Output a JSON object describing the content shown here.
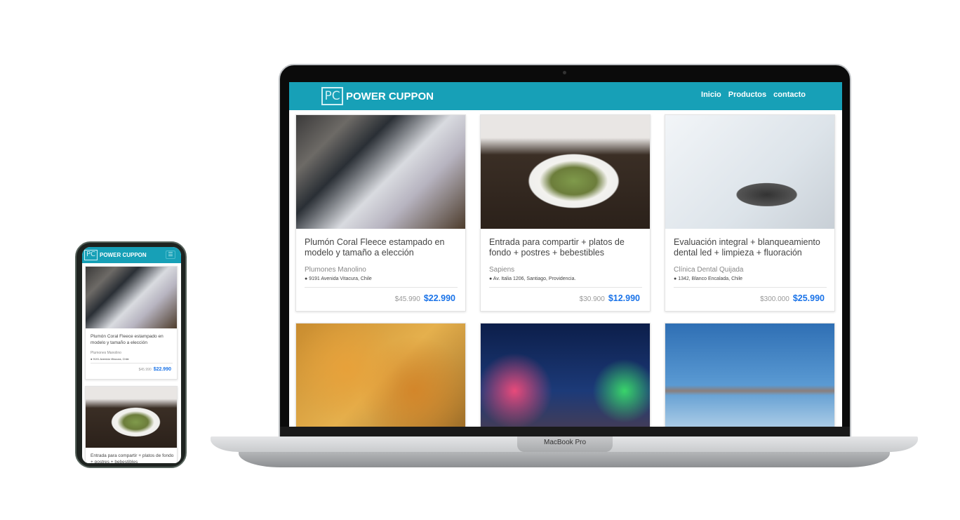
{
  "device_label": "MacBook Pro",
  "brand": {
    "logo_mark": "PC",
    "name": "POWER CUPPON"
  },
  "nav": [
    "Inicio",
    "Productos",
    "contacto"
  ],
  "products": [
    {
      "title": "Plumón Coral Fleece estampado en modelo y tamaño a elección",
      "business": "Plumones Manolino",
      "address": "9191 Avenida Vitacura, Chile",
      "old_price": "$45.990",
      "price": "$22.990"
    },
    {
      "title": "Entrada para compartir + platos de fondo + postres + bebestibles",
      "business": "Sapiens",
      "address": "Av. Italia 1206, Santiago, Providencia.",
      "old_price": "$30.900",
      "price": "$12.990"
    },
    {
      "title": "Evaluación integral + blanqueamiento dental led + limpieza + fluoración",
      "business": "Clínica Dental Quijada",
      "address": "1342, Blanco Encalada, Chile",
      "old_price": "$300.000",
      "price": "$25.990"
    }
  ],
  "mobile": {
    "menu_icon": "☰",
    "second_title": "Entrada para compartir + platos de fondo + postres + bebestibles"
  },
  "colors": {
    "header": "#17a0b7",
    "price": "#1a73e8"
  }
}
